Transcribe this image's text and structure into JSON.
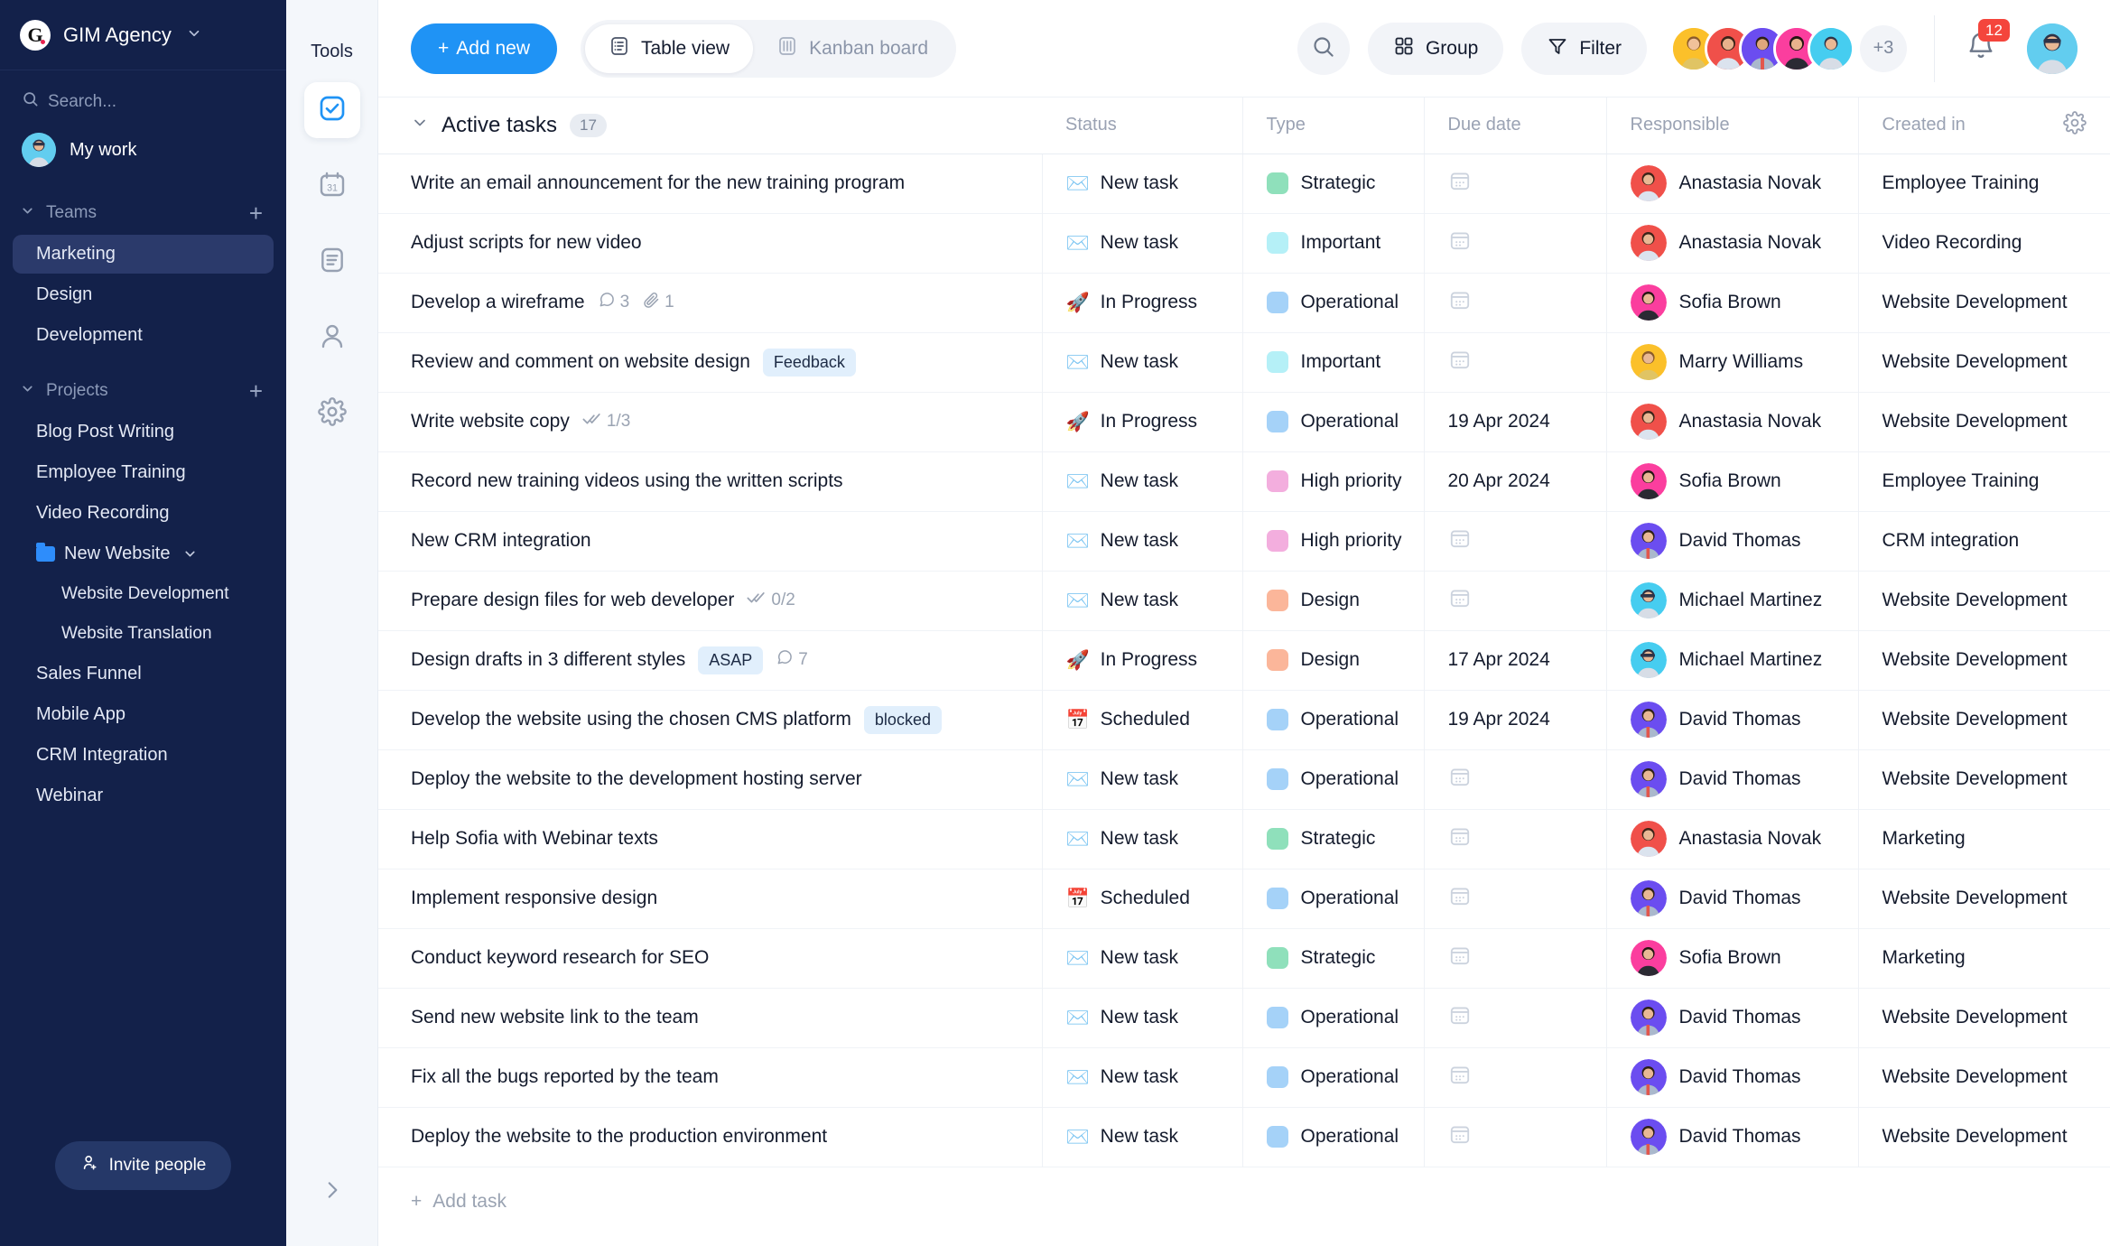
{
  "sidebar": {
    "brand": {
      "name": "GIM Agency",
      "logo_letter": "G",
      "caret": "chevron-down-icon"
    },
    "search": {
      "placeholder": "Search..."
    },
    "my_work": {
      "label": "My work"
    },
    "teams": {
      "label": "Teams",
      "add": "+",
      "items": [
        {
          "label": "Marketing",
          "active": true
        },
        {
          "label": "Design",
          "active": false
        },
        {
          "label": "Development",
          "active": false
        }
      ]
    },
    "projects": {
      "label": "Projects",
      "add": "+",
      "items": [
        {
          "label": "Blog Post Writing",
          "type": "project"
        },
        {
          "label": "Employee Training",
          "type": "project"
        },
        {
          "label": "Video Recording",
          "type": "project"
        },
        {
          "label": "New Website",
          "type": "folder"
        },
        {
          "label": "Website Development",
          "type": "sub"
        },
        {
          "label": "Website Translation",
          "type": "sub"
        },
        {
          "label": "Sales Funnel",
          "type": "project"
        },
        {
          "label": "Mobile App",
          "type": "project"
        },
        {
          "label": "CRM Integration",
          "type": "project"
        },
        {
          "label": "Webinar",
          "type": "project"
        }
      ]
    },
    "invite": {
      "label": "Invite people",
      "icon": "person-add-icon"
    }
  },
  "tools": {
    "title": "Tools",
    "items": [
      {
        "icon": "checkbox-icon",
        "active": true
      },
      {
        "icon": "calendar-31-icon",
        "active": false
      },
      {
        "icon": "document-icon",
        "active": false
      },
      {
        "icon": "person-icon",
        "active": false
      },
      {
        "icon": "gear-icon",
        "active": false
      }
    ],
    "expand": "chevron-right-icon"
  },
  "topbar": {
    "add_new": "Add new",
    "tabs": [
      {
        "label": "Table view",
        "icon": "table-icon",
        "active": true
      },
      {
        "label": "Kanban board",
        "icon": "kanban-icon",
        "active": false
      }
    ],
    "search_icon": "search-icon",
    "group": "Group",
    "filter": "Filter",
    "avatar_overflow": "+3",
    "notification_count": "12",
    "accent": "#1f93f5"
  },
  "table": {
    "group": {
      "label": "Active tasks",
      "count": "17",
      "collapse_icon": "chevron-down-icon",
      "settings_icon": "gear-icon"
    },
    "columns": [
      "",
      "Status",
      "Type",
      "Due date",
      "Responsible",
      "Created in"
    ],
    "add_task": "Add task",
    "type_colors": {
      "Strategic": "#8fe0bb",
      "Important": "#b5f0f7",
      "Operational": "#a5d2f8",
      "High priority": "#f3aede",
      "Design": "#fbb69a"
    },
    "avatar_colors": {
      "Anastasia Novak": "#f0504a",
      "Sofia Brown": "#fb3e9e",
      "Marry Williams": "#fbc02a",
      "David Thomas": "#6b4df0",
      "Michael Martinez": "#46cdf0"
    },
    "status_emoji": {
      "New task": "✉️",
      "In Progress": "🚀",
      "Scheduled": "📅"
    },
    "rows": [
      {
        "task": "Write an email announcement for the new training program",
        "tag": "",
        "meta": [],
        "status": "New task",
        "type": "Strategic",
        "due": "",
        "responsible": "Anastasia Novak",
        "created": "Employee Training"
      },
      {
        "task": "Adjust scripts for new video",
        "tag": "",
        "meta": [],
        "status": "New task",
        "type": "Important",
        "due": "",
        "responsible": "Anastasia Novak",
        "created": "Video Recording"
      },
      {
        "task": "Develop a wireframe",
        "tag": "",
        "meta": [
          {
            "icon": "comment-icon",
            "value": "3"
          },
          {
            "icon": "attachment-icon",
            "value": "1"
          }
        ],
        "status": "In Progress",
        "type": "Operational",
        "due": "",
        "responsible": "Sofia Brown",
        "created": "Website Development"
      },
      {
        "task": "Review and comment on website design",
        "tag": "Feedback",
        "meta": [],
        "status": "New task",
        "type": "Important",
        "due": "",
        "responsible": "Marry Williams",
        "created": "Website Development"
      },
      {
        "task": "Write website copy",
        "tag": "",
        "meta": [
          {
            "icon": "checks-icon",
            "value": "1/3"
          }
        ],
        "status": "In Progress",
        "type": "Operational",
        "due": "19 Apr 2024",
        "responsible": "Anastasia Novak",
        "created": "Website Development"
      },
      {
        "task": "Record new training videos using the written scripts",
        "tag": "",
        "meta": [],
        "status": "New task",
        "type": "High priority",
        "due": "20 Apr 2024",
        "responsible": "Sofia Brown",
        "created": "Employee Training"
      },
      {
        "task": "New CRM integration",
        "tag": "",
        "meta": [],
        "status": "New task",
        "type": "High priority",
        "due": "",
        "responsible": "David Thomas",
        "created": "CRM integration"
      },
      {
        "task": "Prepare design files for web developer",
        "tag": "",
        "meta": [
          {
            "icon": "checks-icon",
            "value": "0/2"
          }
        ],
        "status": "New task",
        "type": "Design",
        "due": "",
        "responsible": "Michael Martinez",
        "created": "Website Development"
      },
      {
        "task": "Design drafts in 3 different styles",
        "tag": "ASAP",
        "meta": [
          {
            "icon": "comment-icon",
            "value": "7"
          }
        ],
        "status": "In Progress",
        "type": "Design",
        "due": "17 Apr 2024",
        "responsible": "Michael Martinez",
        "created": "Website Development"
      },
      {
        "task": "Develop the website using the chosen CMS platform",
        "tag": "blocked",
        "meta": [],
        "status": "Scheduled",
        "type": "Operational",
        "due": "19 Apr 2024",
        "responsible": "David Thomas",
        "created": "Website Development"
      },
      {
        "task": "Deploy the website to the development hosting server",
        "tag": "",
        "meta": [],
        "status": "New task",
        "type": "Operational",
        "due": "",
        "responsible": "David Thomas",
        "created": "Website Development"
      },
      {
        "task": "Help Sofia with Webinar texts",
        "tag": "",
        "meta": [],
        "status": "New task",
        "type": "Strategic",
        "due": "",
        "responsible": "Anastasia Novak",
        "created": "Marketing"
      },
      {
        "task": "Implement responsive design",
        "tag": "",
        "meta": [],
        "status": "Scheduled",
        "type": "Operational",
        "due": "",
        "responsible": "David Thomas",
        "created": "Website Development"
      },
      {
        "task": "Conduct keyword research for SEO",
        "tag": "",
        "meta": [],
        "status": "New task",
        "type": "Strategic",
        "due": "",
        "responsible": "Sofia Brown",
        "created": "Marketing"
      },
      {
        "task": "Send new website link to the team",
        "tag": "",
        "meta": [],
        "status": "New task",
        "type": "Operational",
        "due": "",
        "responsible": "David Thomas",
        "created": "Website Development"
      },
      {
        "task": "Fix all the bugs reported by the team",
        "tag": "",
        "meta": [],
        "status": "New task",
        "type": "Operational",
        "due": "",
        "responsible": "David Thomas",
        "created": "Website Development"
      },
      {
        "task": "Deploy the website to the production environment",
        "tag": "",
        "meta": [],
        "status": "New task",
        "type": "Operational",
        "due": "",
        "responsible": "David Thomas",
        "created": "Website Development"
      }
    ]
  }
}
